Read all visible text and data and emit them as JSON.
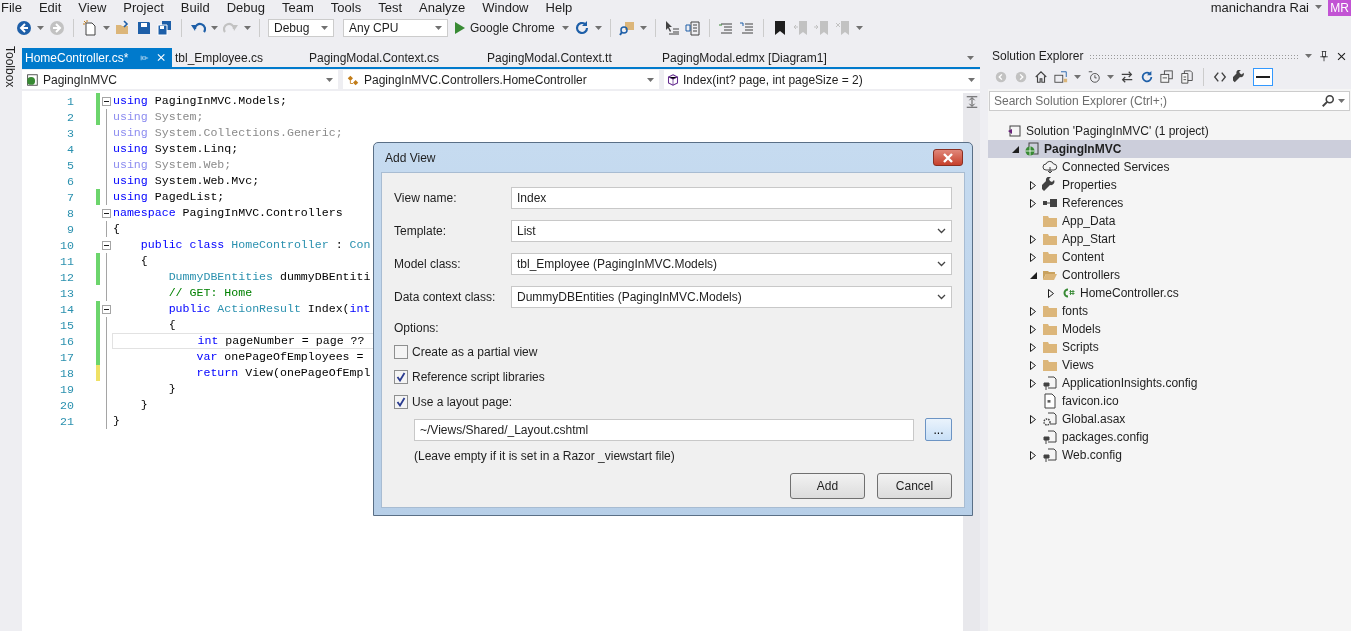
{
  "menu": [
    "File",
    "Edit",
    "View",
    "Project",
    "Build",
    "Debug",
    "Team",
    "Tools",
    "Test",
    "Analyze",
    "Window",
    "Help"
  ],
  "toolbar": {
    "configuration": "Debug",
    "platform": "Any CPU",
    "run_target": "Google Chrome"
  },
  "account": {
    "name": "manichandra Rai",
    "initials": "MR"
  },
  "toolbox_label": "Toolbox",
  "editor": {
    "tabs": [
      {
        "label": "HomeController.cs*",
        "selected": true
      },
      {
        "label": "tbl_Employee.cs",
        "selected": false
      },
      {
        "label": "PagingModal.Context.cs",
        "selected": false
      },
      {
        "label": "PagingModal.Context.tt",
        "selected": false
      },
      {
        "label": "PagingModal.edmx [Diagram1]",
        "selected": false
      }
    ],
    "navigation": [
      "PagingInMVC",
      "PagingInMVC.Controllers.HomeController",
      "Index(int? page, int pageSize = 2)"
    ],
    "lines": [
      {
        "number": "1",
        "color": "#6cd56c",
        "collapsible": true,
        "current": false,
        "tokens": [
          {
            "text": "using",
            "kind": "keyword"
          },
          {
            "text": " PagingInMVC.Models;",
            "kind": "plain"
          }
        ]
      },
      {
        "number": "2",
        "color": "#6cd56c",
        "collapsible": false,
        "current": false,
        "tokens": [
          {
            "text": "using",
            "kind": "faded-keyword"
          },
          {
            "text": " System;",
            "kind": "faded"
          }
        ]
      },
      {
        "number": "3",
        "collapsible": false,
        "current": false,
        "tokens": [
          {
            "text": "using",
            "kind": "faded-keyword"
          },
          {
            "text": " System.Collections.Generic;",
            "kind": "faded"
          }
        ]
      },
      {
        "number": "4",
        "collapsible": false,
        "current": false,
        "tokens": [
          {
            "text": "using",
            "kind": "keyword"
          },
          {
            "text": " System.Linq;",
            "kind": "plain"
          }
        ]
      },
      {
        "number": "5",
        "collapsible": false,
        "current": false,
        "tokens": [
          {
            "text": "using",
            "kind": "faded-keyword"
          },
          {
            "text": " System.Web;",
            "kind": "faded"
          }
        ]
      },
      {
        "number": "6",
        "collapsible": false,
        "current": false,
        "tokens": [
          {
            "text": "using",
            "kind": "keyword"
          },
          {
            "text": " System.Web.Mvc;",
            "kind": "plain"
          }
        ]
      },
      {
        "number": "7",
        "color": "#6cd56c",
        "collapsible": false,
        "current": false,
        "tokens": [
          {
            "text": "using",
            "kind": "keyword"
          },
          {
            "text": " PagedList;",
            "kind": "plain"
          }
        ]
      },
      {
        "number": "8",
        "collapsible": true,
        "current": false,
        "tokens": [
          {
            "text": "namespace",
            "kind": "keyword"
          },
          {
            "text": " PagingInMVC.Controllers",
            "kind": "plain"
          }
        ]
      },
      {
        "number": "9",
        "collapsible": false,
        "current": false,
        "tokens": [
          {
            "text": "{",
            "kind": "plain"
          }
        ]
      },
      {
        "number": "10",
        "collapsible": true,
        "current": false,
        "tokens": [
          {
            "text": "    public class",
            "kind": "keyword"
          },
          {
            "text": " HomeController",
            "kind": "type"
          },
          {
            "text": " :",
            "kind": "plain"
          },
          {
            "text": " Con",
            "kind": "type"
          }
        ]
      },
      {
        "number": "11",
        "color": "#6cd56c",
        "collapsible": false,
        "current": false,
        "tokens": [
          {
            "text": "    {",
            "kind": "plain"
          }
        ]
      },
      {
        "number": "12",
        "color": "#6cd56c",
        "collapsible": false,
        "current": false,
        "tokens": [
          {
            "text": "        DummyDBEntities",
            "kind": "type"
          },
          {
            "text": " dummyDBEntiti",
            "kind": "plain"
          }
        ]
      },
      {
        "number": "13",
        "collapsible": false,
        "current": false,
        "tokens": [
          {
            "text": "        // GET: Home",
            "kind": "comment"
          }
        ]
      },
      {
        "number": "14",
        "color": "#6cd56c",
        "collapsible": true,
        "current": false,
        "tokens": [
          {
            "text": "        public",
            "kind": "keyword"
          },
          {
            "text": " ActionResult",
            "kind": "type"
          },
          {
            "text": " Index(",
            "kind": "plain"
          },
          {
            "text": "int",
            "kind": "keyword"
          }
        ]
      },
      {
        "number": "15",
        "color": "#6cd56c",
        "collapsible": false,
        "current": false,
        "tokens": [
          {
            "text": "        {",
            "kind": "plain"
          }
        ]
      },
      {
        "number": "16",
        "color": "#6cd56c",
        "collapsible": false,
        "current": true,
        "tokens": [
          {
            "text": "            int",
            "kind": "keyword"
          },
          {
            "text": " pageNumber = page ??",
            "kind": "plain"
          }
        ]
      },
      {
        "number": "17",
        "color": "#6cd56c",
        "collapsible": false,
        "current": false,
        "tokens": [
          {
            "text": "            var",
            "kind": "keyword"
          },
          {
            "text": " onePageOfEmployees =",
            "kind": "plain"
          }
        ]
      },
      {
        "number": "18",
        "color": "#efe165",
        "collapsible": false,
        "current": false,
        "tokens": [
          {
            "text": "            return",
            "kind": "keyword"
          },
          {
            "text": " View(onePageOfEmpl",
            "kind": "plain"
          }
        ]
      },
      {
        "number": "19",
        "collapsible": false,
        "current": false,
        "tokens": [
          {
            "text": "        }",
            "kind": "plain"
          }
        ]
      },
      {
        "number": "20",
        "collapsible": false,
        "current": false,
        "tokens": [
          {
            "text": "    }",
            "kind": "plain"
          }
        ]
      },
      {
        "number": "21",
        "collapsible": false,
        "current": false,
        "tokens": [
          {
            "text": "}",
            "kind": "plain"
          }
        ]
      }
    ]
  },
  "dialog": {
    "title": "Add View",
    "fields": [
      {
        "label": "View name:",
        "value": "Index",
        "kind": "text"
      },
      {
        "label": "Template:",
        "value": "List",
        "kind": "select"
      },
      {
        "label": "Model class:",
        "value": "tbl_Employee (PagingInMVC.Models)",
        "kind": "select"
      },
      {
        "label": "Data context class:",
        "value": "DummyDBEntities (PagingInMVC.Models)",
        "kind": "select"
      }
    ],
    "options_label": "Options:",
    "options": [
      {
        "label": "Create as a partial view",
        "checked": false
      },
      {
        "label": "Reference script libraries",
        "checked": true
      },
      {
        "label": "Use a layout page:",
        "checked": true
      }
    ],
    "layout_path": "~/Views/Shared/_Layout.cshtml",
    "browse_button": "...",
    "hint": "(Leave empty if it is set in a Razor _viewstart file)",
    "buttons": [
      "Add",
      "Cancel"
    ]
  },
  "solution_explorer": {
    "title": "Solution Explorer",
    "search_placeholder": "Search Solution Explorer (Ctrl+;)",
    "tree": [
      {
        "label": "Solution 'PagingInMVC' (1 project)",
        "kind": "solution",
        "selected": false,
        "children": [
          {
            "label": "PagingInMVC",
            "kind": "project",
            "expanded": true,
            "selected": true,
            "children": [
              {
                "label": "Connected Services",
                "kind": "cloud",
                "selected": false
              },
              {
                "label": "Properties",
                "kind": "wrench",
                "expanded": false,
                "selected": false
              },
              {
                "label": "References",
                "kind": "references",
                "expanded": false,
                "selected": false
              },
              {
                "label": "App_Data",
                "kind": "folder",
                "selected": false
              },
              {
                "label": "App_Start",
                "kind": "folder",
                "expanded": false,
                "selected": false
              },
              {
                "label": "Content",
                "kind": "folder",
                "expanded": false,
                "selected": false
              },
              {
                "label": "Controllers",
                "kind": "folder",
                "expanded": true,
                "selected": false,
                "children": [
                  {
                    "label": "HomeController.cs",
                    "kind": "csharp",
                    "expanded": false,
                    "selected": false
                  }
                ]
              },
              {
                "label": "fonts",
                "kind": "folder",
                "expanded": false,
                "selected": false
              },
              {
                "label": "Models",
                "kind": "folder",
                "expanded": false,
                "selected": false
              },
              {
                "label": "Scripts",
                "kind": "folder",
                "expanded": false,
                "selected": false
              },
              {
                "label": "Views",
                "kind": "folder",
                "expanded": false,
                "selected": false
              },
              {
                "label": "ApplicationInsights.config",
                "kind": "config",
                "expanded": false,
                "selected": false
              },
              {
                "label": "favicon.ico",
                "kind": "image-file",
                "selected": false
              },
              {
                "label": "Global.asax",
                "kind": "gear-file",
                "expanded": false,
                "selected": false
              },
              {
                "label": "packages.config",
                "kind": "config",
                "selected": false
              },
              {
                "label": "Web.config",
                "kind": "config",
                "expanded": false,
                "selected": false
              }
            ]
          }
        ]
      }
    ]
  }
}
